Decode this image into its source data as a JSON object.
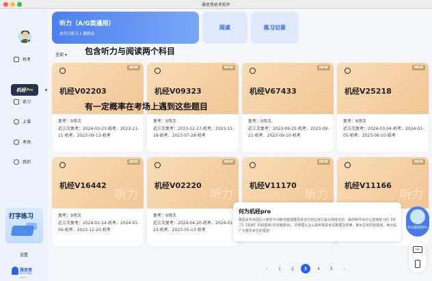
{
  "window": {
    "title": "雅思哥机考软件"
  },
  "sidebar": {
    "items": [
      {
        "label": "机考",
        "icon": "monitor-icon"
      },
      {
        "label": "机经",
        "sub": "Pro"
      },
      {
        "label": "练习",
        "icon": "practice-icon"
      },
      {
        "label": "上课",
        "icon": "clock-icon"
      },
      {
        "label": "考场",
        "icon": "chat-icon"
      },
      {
        "label": "我的",
        "icon": "user-icon"
      }
    ],
    "promo": "打字练习",
    "settings": "设置",
    "logo": {
      "name": "雅思哥",
      "en": "IELTS BRO",
      "year": "2024"
    }
  },
  "header": {
    "main_tab": {
      "title": "听力（A/G类通用）",
      "subtitle": "本月已练习 1 篇机经"
    },
    "tabs": [
      "阅读",
      "练习记录"
    ]
  },
  "filter": {
    "label": "全部"
  },
  "overlays": {
    "line1": "包含听力与阅读两个科目",
    "line2": "有一定概率在考场上遇到这些题目"
  },
  "cards": [
    {
      "code": "机经V02203",
      "review": "复考：9场次",
      "history": "近三次复考：2024-03-23-纸考、2023-11-11-机考、2023-09-13-机考",
      "badge": "NEW",
      "watermark": ""
    },
    {
      "code": "机经V09323",
      "review": "复考：9场次",
      "history": "近三次复考：2023-12-17-机考、2023-11-18-纸考、2023-07-28-机考",
      "badge": "NEW",
      "watermark": ""
    },
    {
      "code": "机经V67433",
      "review": "复考：9场次",
      "history": "近三次复考：2023-09-25-机考、2023-09-21-机考、2023-09-10-机考",
      "badge": "NEW",
      "watermark": ""
    },
    {
      "code": "机经V25218",
      "review": "复考：8场次",
      "history": "近三次复考：2024-03-04-机考、2024-01-05-机考、2023-06-10-纸考",
      "badge": "NEW",
      "watermark": ""
    },
    {
      "code": "机经V16442",
      "review": "复考：9场次",
      "history": "近三次复考：2024-01-24-机考、2024-01-06-机考、2023-12-20-机考",
      "badge": "NEW",
      "watermark": "听力"
    },
    {
      "code": "机经V02220",
      "review": "复考：9场次",
      "history": "近三次复考：2024-04-20-机考、2024-01-23-机考、2023-05-13-机考",
      "badge": "NEW",
      "watermark": "听力"
    },
    {
      "code": "机经V11170",
      "review": "",
      "history": "",
      "badge": "NEW",
      "watermark": "听力"
    },
    {
      "code": "机经V11166",
      "review": "",
      "history": "",
      "badge": "NEW",
      "watermark": "听力"
    }
  ],
  "tooltip": {
    "title": "何为机经pro",
    "body": "雅思哥学术团队十数年不间断地整理雅思考试内容后进行最大限度还原。最终制作出可以直接练习的【听力】【阅读】机经题库(非剑雅题目)。并根据从业以来积累的考试数据及规律，推出在考机经题库。绝对是广大雅思考生的福音!"
  },
  "float": {
    "assistant": "什么是机经Pro",
    "tool": "PDF"
  },
  "pagination": {
    "prev": "‹",
    "pages": [
      "1",
      "2",
      "3",
      "4",
      "5"
    ],
    "active": "3",
    "next": "›"
  }
}
